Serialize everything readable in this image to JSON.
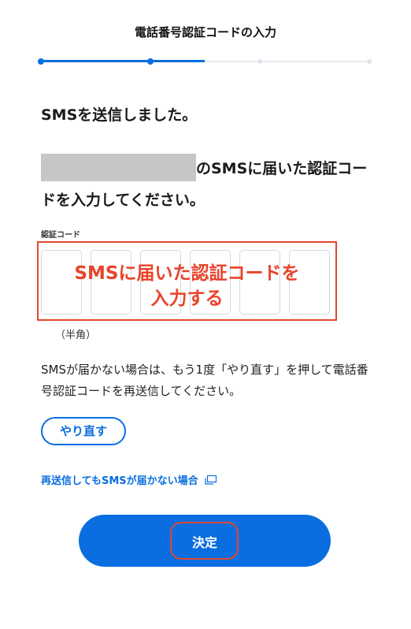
{
  "header": {
    "title": "電話番号認証コードの入力"
  },
  "progress": {
    "steps_total": 4,
    "current_step": 2
  },
  "message": {
    "heading": "SMSを送信しました。",
    "desc_part": "のSMSに届いた認証コードを入力してください。"
  },
  "code": {
    "label": "認証コード",
    "box_count": 6,
    "annotation_line1": "SMSに届いた認証コードを",
    "annotation_line2": "入力する",
    "note": "（半角）"
  },
  "info": {
    "text": "SMSが届かない場合は、もう1度「やり直す」を押して電話番号認証コードを再送信してください。"
  },
  "retry": {
    "label": "やり直す"
  },
  "help": {
    "link_text": "再送信してもSMSが届かない場合"
  },
  "submit": {
    "label": "決定"
  },
  "colors": {
    "accent": "#0a6ee0",
    "annotation": "#e0472f"
  }
}
